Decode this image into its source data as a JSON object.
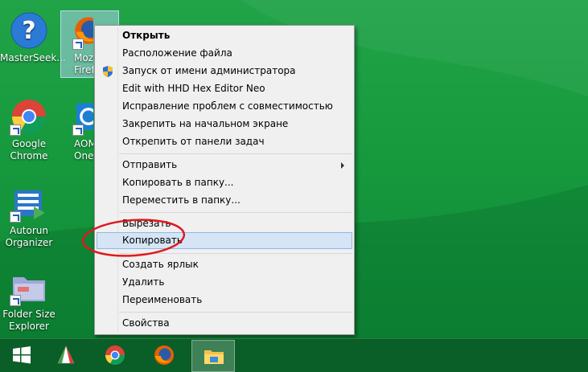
{
  "desktop": {
    "icons": [
      {
        "label_line1": "MasterSeek...",
        "label_line2": "",
        "icon": "help-question-icon"
      },
      {
        "label_line1": "Mozi",
        "label_line2": "Firef",
        "icon": "firefox-icon"
      },
      {
        "label_line1": "Google",
        "label_line2": "Chrome",
        "icon": "chrome-icon"
      },
      {
        "label_line1": "AOM",
        "label_line2": "OneK",
        "icon": "aomei-onekey-icon"
      },
      {
        "label_line1": "Autorun",
        "label_line2": "Organizer",
        "icon": "autorun-organizer-icon"
      },
      {
        "label_line1": "Folder Size",
        "label_line2": "Explorer",
        "icon": "folder-size-explorer-icon"
      }
    ]
  },
  "context_menu": {
    "group1": [
      {
        "label": "Открыть"
      },
      {
        "label": "Расположение файла"
      },
      {
        "label": "Запуск от имени администратора"
      },
      {
        "label": "Edit with HHD Hex Editor Neo"
      },
      {
        "label": "Исправление проблем с совместимостью"
      },
      {
        "label": "Закрепить на начальном экране"
      },
      {
        "label": "Открепить от панели задач"
      }
    ],
    "group2": [
      {
        "label": "Отправить"
      },
      {
        "label": "Копировать в папку..."
      },
      {
        "label": "Переместить в папку..."
      }
    ],
    "group3": [
      {
        "label": "Вырезать"
      },
      {
        "label": "Копировать"
      }
    ],
    "group4": [
      {
        "label": "Создать ярлык"
      },
      {
        "label": "Удалить"
      },
      {
        "label": "Переименовать"
      }
    ],
    "group5": [
      {
        "label": "Свойства"
      }
    ]
  },
  "taskbar": {
    "items": [
      {
        "icon": "windows-start-icon"
      },
      {
        "icon": "app-pinned-icon"
      },
      {
        "icon": "chrome-icon"
      },
      {
        "icon": "firefox-icon"
      },
      {
        "icon": "file-explorer-icon"
      }
    ]
  },
  "colors": {
    "desktop_green": "#179a3e",
    "menu_bg": "#f0f0f0",
    "menu_highlight": "#d5e5f6",
    "annotation_red": "#e0191e"
  }
}
